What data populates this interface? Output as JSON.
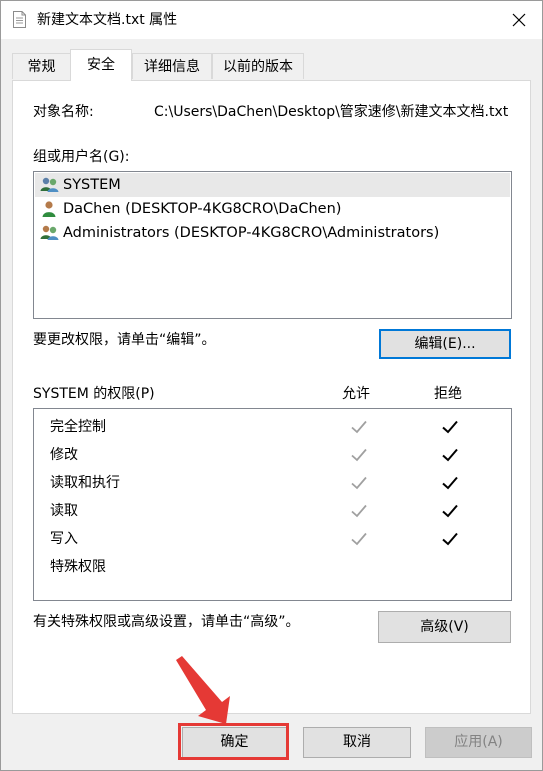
{
  "window": {
    "title": "新建文本文档.txt 属性",
    "title_icon": "text-document-icon",
    "close_icon": "close-icon"
  },
  "tabs": [
    {
      "label": "常规",
      "active": false
    },
    {
      "label": "安全",
      "active": true
    },
    {
      "label": "详细信息",
      "active": false
    },
    {
      "label": "以前的版本",
      "active": false
    }
  ],
  "security": {
    "object_name_label": "对象名称:",
    "object_name_value": "C:\\Users\\DaChen\\Desktop\\管家速修\\新建文本文档.txt",
    "groups_label": "组或用户名(G):",
    "users": [
      {
        "name": "SYSTEM",
        "icon": "user-group-icon",
        "selected": true
      },
      {
        "name": "DaChen (DESKTOP-4KG8CRO\\DaChen)",
        "icon": "user-icon",
        "selected": false
      },
      {
        "name": "Administrators (DESKTOP-4KG8CRO\\Administrators)",
        "icon": "user-group-icon",
        "selected": false
      }
    ],
    "change_hint": "要更改权限，请单击“编辑”。",
    "edit_button": "编辑(E)...",
    "permissions_for": "SYSTEM 的权限(P)",
    "allow_header": "允许",
    "deny_header": "拒绝",
    "permissions": [
      {
        "name": "完全控制",
        "allow": true,
        "deny": true
      },
      {
        "name": "修改",
        "allow": true,
        "deny": true
      },
      {
        "name": "读取和执行",
        "allow": true,
        "deny": true
      },
      {
        "name": "读取",
        "allow": true,
        "deny": true
      },
      {
        "name": "写入",
        "allow": true,
        "deny": true
      },
      {
        "name": "特殊权限",
        "allow": false,
        "deny": false
      }
    ],
    "advanced_hint": "有关特殊权限或高级设置，请单击“高级”。",
    "advanced_button": "高级(V)"
  },
  "footer": {
    "ok_button": "确定",
    "cancel_button": "取消",
    "apply_button": "应用(A)"
  },
  "colors": {
    "accent": "#0078d7",
    "annotation_red": "#e53935",
    "check_inherited": "#a0a0a0",
    "check_explicit": "#000000"
  }
}
